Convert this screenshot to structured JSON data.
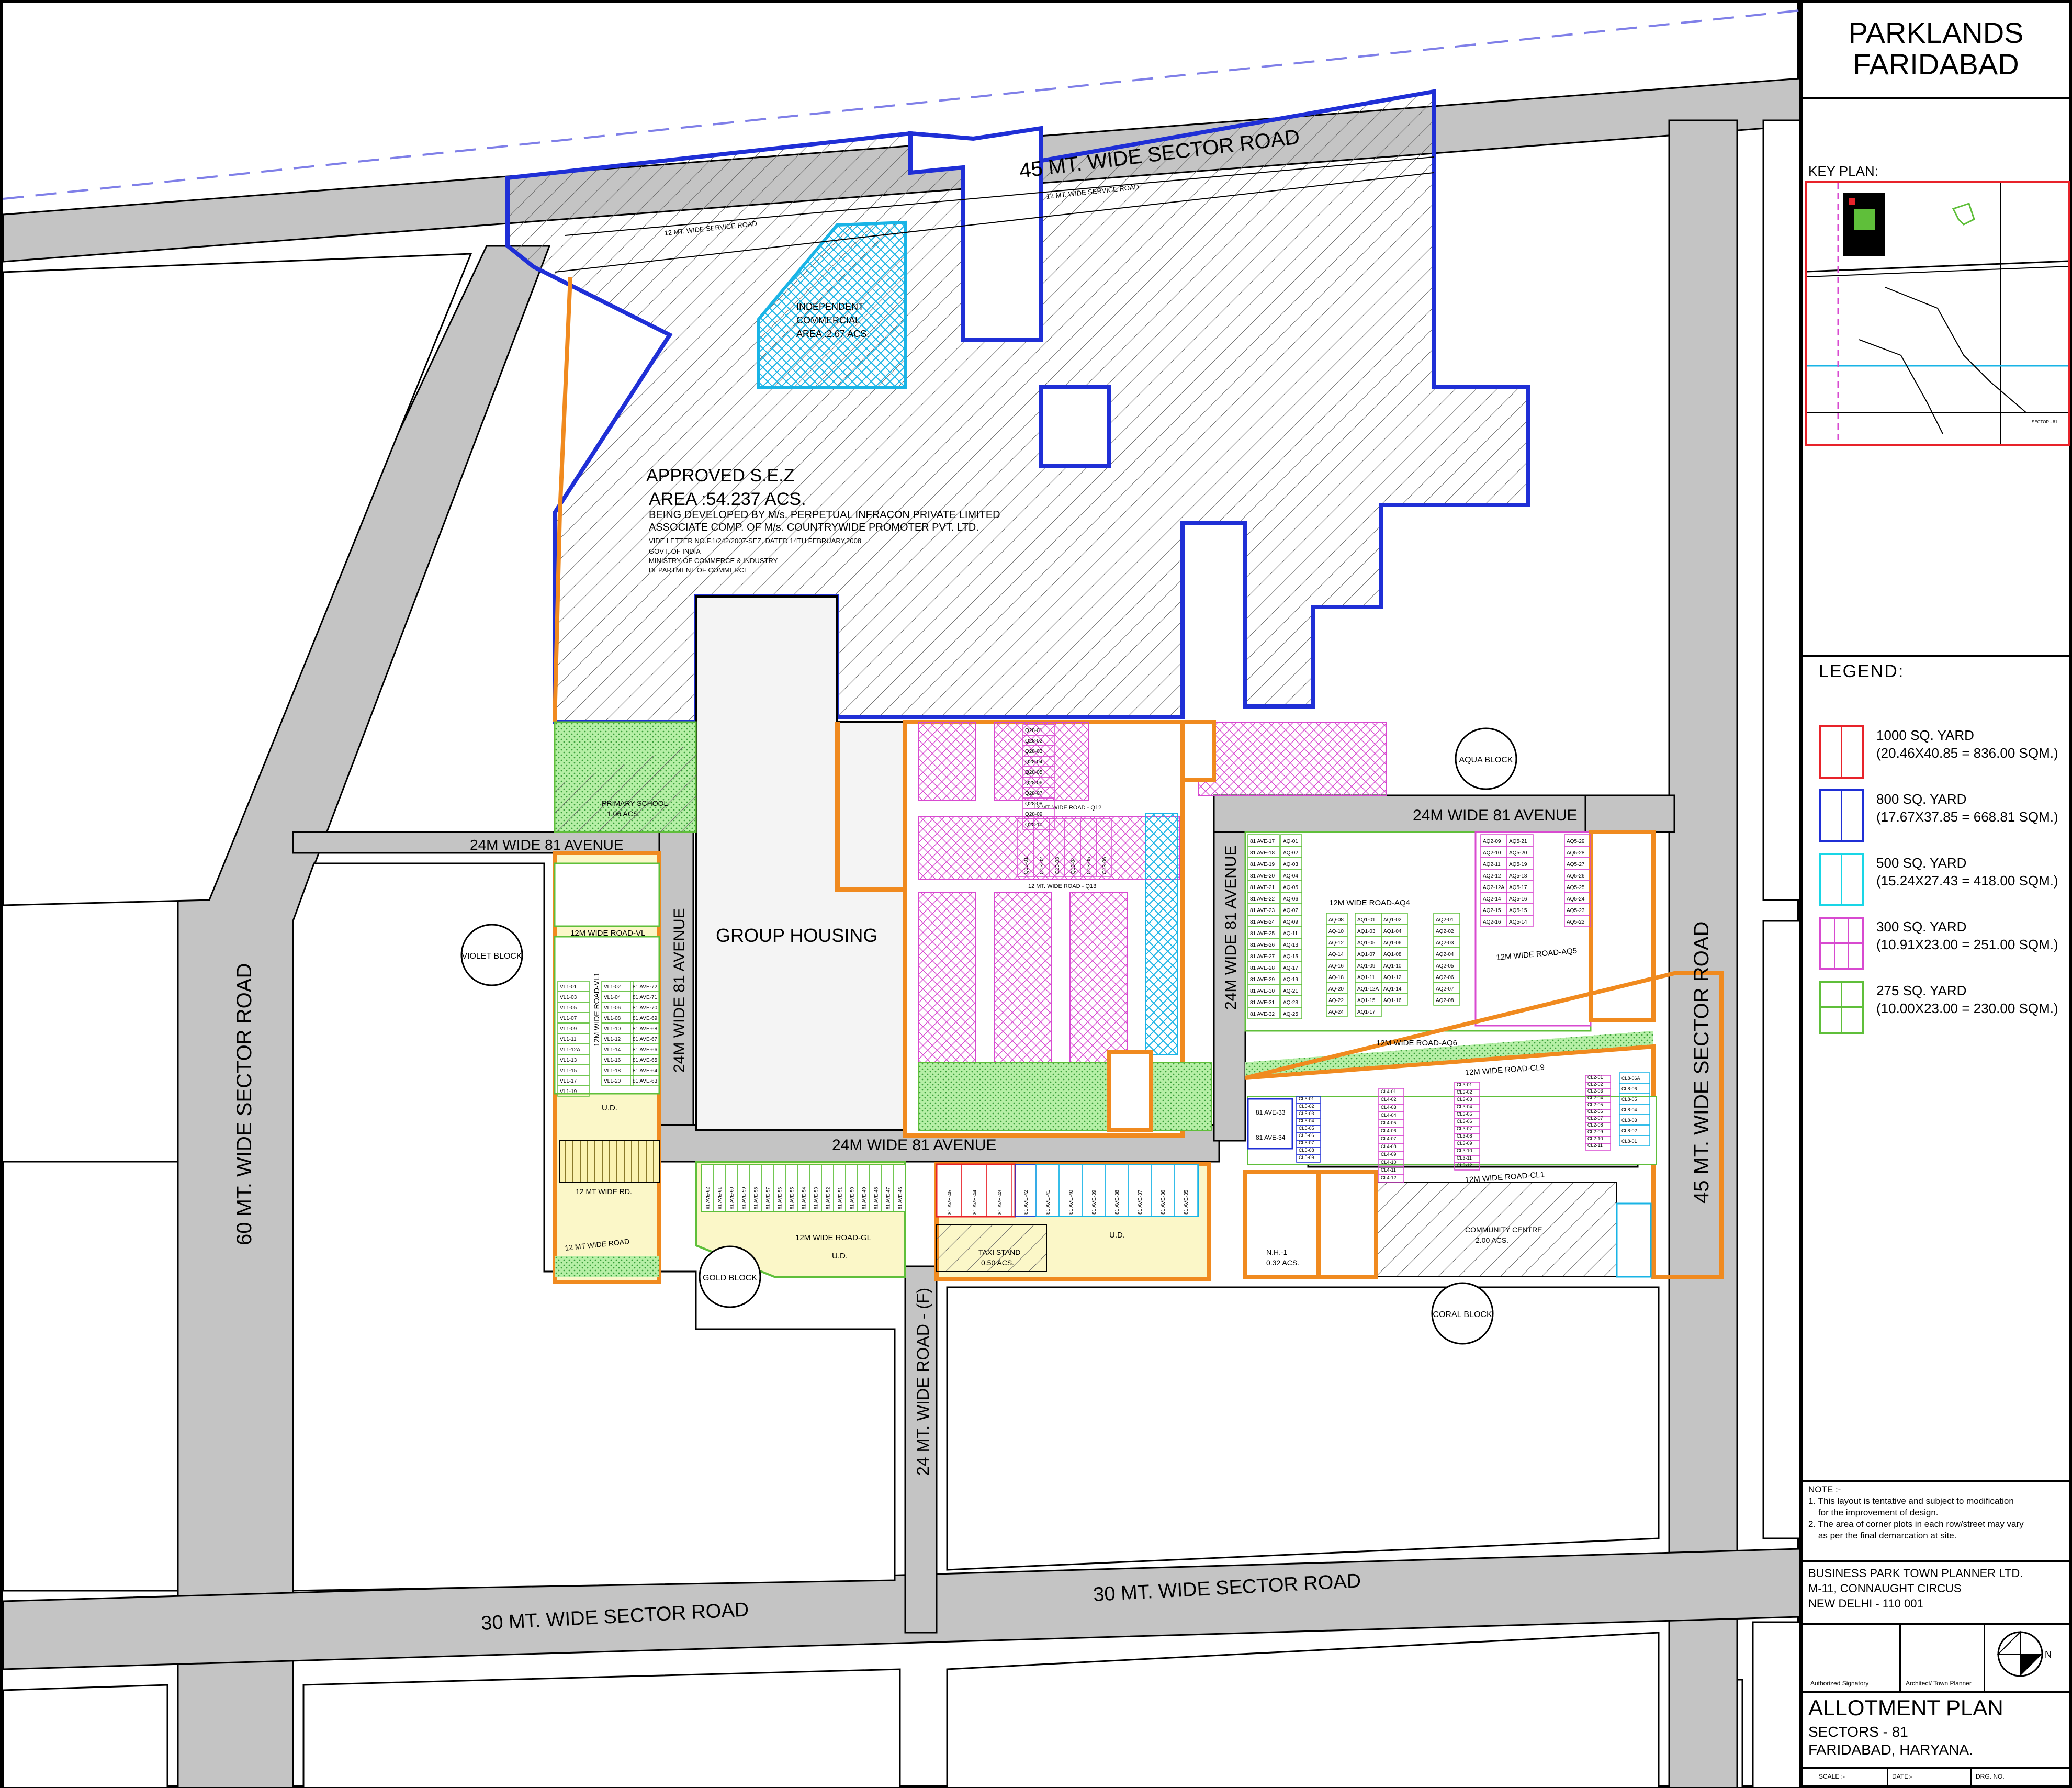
{
  "project": {
    "title_line1": "PARKLANDS",
    "title_line2": "FARIDABAD"
  },
  "key_plan": {
    "label": "KEY PLAN:",
    "sector_label": "SECTOR - 81"
  },
  "legend": {
    "title": "LEGEND:",
    "items": [
      {
        "size": "1000  SQ. YARD",
        "dims": "(20.46X40.85 = 836.00 SQM.)",
        "color": "#e8232a"
      },
      {
        "size": "800  SQ. YARD",
        "dims": "(17.67X37.85 = 668.81 SQM.)",
        "color": "#1f2fd6"
      },
      {
        "size": "500  SQ. YARD",
        "dims": "(15.24X27.43 = 418.00 SQM.)",
        "color": "#19d6e6"
      },
      {
        "size": "300  SQ. YARD",
        "dims": "(10.91X23.00 = 251.00 SQM.)",
        "color": "#d84ad0"
      },
      {
        "size": "275 SQ. YARD",
        "dims": "(10.00X23.00 = 230.00 SQM.)",
        "color": "#5fbf3a"
      }
    ]
  },
  "notes": {
    "title": "NOTE :-",
    "items": [
      "1. This layout is tentative and subject to modification",
      "    for the improvement of design.",
      "2. The area of corner plots in each row/street may vary",
      "    as per the final demarcation at site."
    ]
  },
  "company": {
    "name": "BUSINESS PARK TOWN PLANNER LTD.",
    "address1": "M-11, CONNAUGHT CIRCUS",
    "address2": "NEW DELHI - 110 001"
  },
  "signatures": {
    "left": "Authorized Signatory",
    "right": "Architect/ Town Planner"
  },
  "north": "N",
  "drawing": {
    "title": "ALLOTMENT PLAN",
    "sector": "SECTORS - 81",
    "place": "FARIDABAD, HARYANA."
  },
  "footer": {
    "scale": "SCALE :-",
    "date": "DATE:-",
    "drg": "DRG. NO."
  },
  "colors": {
    "road": "#c4c4c4",
    "orange": "#f08a1f",
    "blue": "#1f2fd6",
    "cyan": "#19b4e6",
    "green": "#8fe07a",
    "pink": "#d84ad0",
    "lightgreen": "#5fbf3a",
    "yellow": "#fbf7c8",
    "hatch": "#555555"
  },
  "map": {
    "roads": {
      "sector45_top": "45 MT. WIDE  SECTOR ROAD",
      "service_road_1": "12 MT. WIDE SERVICE ROAD",
      "service_road_2": "12 MT. WIDE SERVICE ROAD",
      "sector60": "60 MT. WIDE  SECTOR ROAD",
      "sector45_right": "45 MT. WIDE  SECTOR ROAD",
      "sector30_left": "30 MT. WIDE  SECTOR ROAD",
      "sector30_right": "30 MT. WIDE  SECTOR ROAD",
      "road24f": "24 MT. WIDE ROAD - (F)",
      "ave_left": "24M WIDE 81 AVENUE",
      "ave_vertical": "24M WIDE 81 AVENUE",
      "ave_bottom": "24M WIDE 81 AVENUE",
      "ave_center": "24M WIDE 81 AVENUE",
      "ave_right": "24M WIDE 81 AVENUE"
    },
    "sez": {
      "l1": "APPROVED S.E.Z",
      "l2": "AREA :54.237 ACS.",
      "l3": "BEING DEVELOPED BY M/s. PERPETUAL INFRACON PRIVATE LIMITED",
      "l4": "ASSOCIATE COMP. OF M/s. COUNTRYWIDE PROMOTER PVT. LTD.",
      "l5": "VIDE LETTER NO.F.1/242/2007-SEZ, DATED 14TH FEBRUARY,2008",
      "l6": "GOVT. OF INDIA",
      "l7": "MINISTRY OF COMMERCE & INDUSTRY",
      "l8": "DEPARTMENT OF COMMERCE"
    },
    "commercial": {
      "l1": "INDEPENDENT",
      "l2": "COMMERCIAL",
      "l3": "AREA :2.67 ACS."
    },
    "group_housing": "GROUP HOUSING",
    "primary_school": {
      "l1": "PRIMARY SCHOOL",
      "l2": "1.06 ACS."
    },
    "blocks": {
      "violet": "VIOLET BLOCK",
      "gold": "GOLD BLOCK",
      "aqua": "AQUA BLOCK",
      "coral": "CORAL BLOCK"
    },
    "internal_roads": {
      "vl_top": "12M WIDE ROAD-VL",
      "vl1": "12M WIDE ROAD-VL1",
      "mt_rd": "12 MT WIDE RD.",
      "mt_road": "12 MT WIDE ROAD",
      "gl": "12M WIDE ROAD-GL",
      "q12": "12 MT. WIDE ROAD - Q12",
      "q13": "12 MT. WIDE ROAD - Q13",
      "aq4": "12M WIDE ROAD-AQ4",
      "aq5": "12M WIDE ROAD-AQ5",
      "aq6": "12M WIDE ROAD-AQ6",
      "cl9": "12M WIDE ROAD-CL9",
      "cl1": "12M WIDE ROAD-CL1"
    },
    "ud_labels": [
      "U.D.",
      "U.D.",
      "U.D."
    ],
    "taxi": {
      "l1": "TAXI STAND",
      "l2": "0.50 ACS."
    },
    "nh1": {
      "l1": "N.H.-1",
      "l2": "0.32 ACS."
    },
    "community": {
      "l1": "COMMUNITY CENTRE",
      "l2": "2.00 ACS."
    },
    "plots": {
      "vl_left": [
        "VL1-01",
        "VL1-03",
        "VL1-05",
        "VL1-07",
        "VL1-09",
        "VL1-11",
        "VL1-12A",
        "VL1-13",
        "VL1-15",
        "VL1-17",
        "VL1-19"
      ],
      "vl_mid": [
        "VL1-02",
        "VL1-04",
        "VL1-06",
        "VL1-08",
        "VL1-10",
        "VL1-12",
        "VL1-14",
        "VL1-16",
        "VL1-18",
        "VL1-20"
      ],
      "vl_right": [
        "81 AVE-72",
        "81 AVE-71",
        "81 AVE-70",
        "81 AVE-69",
        "81 AVE-68",
        "81 AVE-67",
        "81 AVE-66",
        "81 AVE-65",
        "81 AVE-64",
        "81 AVE-63"
      ],
      "q28": [
        "Q28-01",
        "Q28-02",
        "Q28-03",
        "Q28-04",
        "Q28-05",
        "Q28-06",
        "Q28-07",
        "Q28-08",
        "Q28-09",
        "Q28-10"
      ],
      "q13": [
        "Q13-01",
        "Q13-02",
        "Q13-03",
        "Q13-04",
        "Q13-05",
        "Q13-06"
      ],
      "aq_left": [
        "81 AVE-17",
        "81 AVE-18",
        "81 AVE-19",
        "81 AVE-20",
        "81 AVE-21",
        "81 AVE-22",
        "81 AVE-23",
        "81 AVE-24",
        "81 AVE-25",
        "81 AVE-26",
        "81 AVE-27",
        "81 AVE-28",
        "81 AVE-29",
        "81 AVE-30",
        "81 AVE-31",
        "81 AVE-32"
      ],
      "aq_col": [
        "AQ-01",
        "AQ-02",
        "AQ-03",
        "AQ-04",
        "AQ-05",
        "AQ-06",
        "AQ-07",
        "AQ-09",
        "AQ-11",
        "AQ-13",
        "AQ-15",
        "AQ-17",
        "AQ-19",
        "AQ-21",
        "AQ-23",
        "AQ-25"
      ],
      "aq_col2": [
        "AQ-08",
        "AQ-10",
        "AQ-12",
        "AQ-14",
        "AQ-16",
        "AQ-18",
        "AQ-20",
        "AQ-22",
        "AQ-24"
      ],
      "aq1": [
        "AQ1-01",
        "AQ1-03",
        "AQ1-05",
        "AQ1-07",
        "AQ1-09",
        "AQ1-11",
        "AQ1-12A",
        "AQ1-15",
        "AQ1-17"
      ],
      "aq1b": [
        "AQ1-02",
        "AQ1-04",
        "AQ1-06",
        "AQ1-08",
        "AQ1-10",
        "AQ1-12",
        "AQ1-14",
        "AQ1-16"
      ],
      "aq2": [
        "AQ2-01",
        "AQ2-02",
        "AQ2-03",
        "AQ2-04",
        "AQ2-05",
        "AQ2-06",
        "AQ2-07",
        "AQ2-08"
      ],
      "aq2b": [
        "AQ2-09",
        "AQ2-10",
        "AQ2-11",
        "AQ2-12",
        "AQ2-12A",
        "AQ2-14",
        "AQ2-15",
        "AQ2-16"
      ],
      "aq5": [
        "AQ5-21",
        "AQ5-20",
        "AQ5-19",
        "AQ5-18",
        "AQ5-17",
        "AQ5-16",
        "AQ5-15",
        "AQ5-14"
      ],
      "aq5b": [
        "AQ5-29",
        "AQ5-28",
        "AQ5-27",
        "AQ5-26",
        "AQ5-25",
        "AQ5-24",
        "AQ5-23",
        "AQ5-22"
      ],
      "cl5": [
        "CL5-01",
        "CL5-02",
        "CL5-03",
        "CL5-04",
        "CL5-05",
        "CL5-06",
        "CL5-07",
        "CL5-08",
        "CL5-09"
      ],
      "cl4": [
        "CL4-01",
        "CL4-02",
        "CL4-03",
        "CL4-04",
        "CL4-05",
        "CL4-06",
        "CL4-07",
        "CL4-08",
        "CL4-09",
        "CL4-10",
        "CL4-11",
        "CL4-12"
      ],
      "cl3": [
        "CL3-01",
        "CL3-02",
        "CL3-03",
        "CL3-04",
        "CL3-05",
        "CL3-06",
        "CL3-07",
        "CL3-08",
        "CL3-09",
        "CL3-10",
        "CL3-11",
        "CL3-12"
      ],
      "cl2": [
        "CL2-01",
        "CL2-02",
        "CL2-03",
        "CL2-04",
        "CL2-05",
        "CL2-06",
        "CL2-07",
        "CL2-08",
        "CL2-09",
        "CL2-10",
        "CL2-11"
      ],
      "cl8": [
        "CL8-06A",
        "CL8-06",
        "CL8-05",
        "CL8-04",
        "CL8-03",
        "CL8-02",
        "CL8-01"
      ],
      "ave33": "81 AVE-33",
      "ave34": "81 AVE-34",
      "gold_row": [
        "81 AVE-62",
        "81 AVE-61",
        "81 AVE-60",
        "81 AVE-59",
        "81 AVE-58",
        "81 AVE-57",
        "81 AVE-56",
        "81 AVE-55",
        "81 AVE-54",
        "81 AVE-53",
        "81 AVE-52",
        "81 AVE-51",
        "81 AVE-50",
        "81 AVE-49",
        "81 AVE-48",
        "81 AVE-47",
        "81 AVE-46"
      ],
      "red_row": [
        "81 AVE-45",
        "81 AVE-44",
        "81 AVE-43"
      ],
      "blue_row": [
        "81 AVE-42"
      ],
      "cyan_row": [
        "81 AVE-41",
        "81 AVE-40",
        "81 AVE-39",
        "81 AVE-38",
        "81 AVE-37",
        "81 AVE-36",
        "81 AVE-35"
      ]
    }
  }
}
